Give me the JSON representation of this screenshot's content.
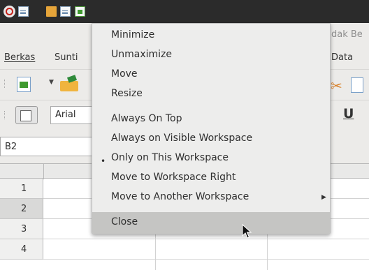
{
  "window": {
    "title_fragment": "dak Be"
  },
  "menubar": {
    "items": [
      "Berkas",
      "Sunti",
      "Data"
    ]
  },
  "toolbar": {
    "font_name": "Arial",
    "underline_label": "U"
  },
  "namebox": {
    "value": "B2"
  },
  "grid": {
    "rows": [
      "1",
      "2",
      "3",
      "4"
    ],
    "selected_row": "2"
  },
  "window_menu": {
    "items": [
      "Minimize",
      "Unmaximize",
      "Move",
      "Resize",
      "Always On Top",
      "Always on Visible Workspace",
      "Only on This Workspace",
      "Move to Workspace Right",
      "Move to Another Workspace",
      "Close"
    ],
    "checked_item": "Only on This Workspace",
    "bullet_glyph": "•",
    "submenu_arrow_glyph": "▶",
    "highlighted_item": "Close"
  },
  "colors": {
    "taskbar": "#2b2b2b",
    "menu_bg": "#ededec",
    "menu_highlight": "#c5c5c3"
  }
}
